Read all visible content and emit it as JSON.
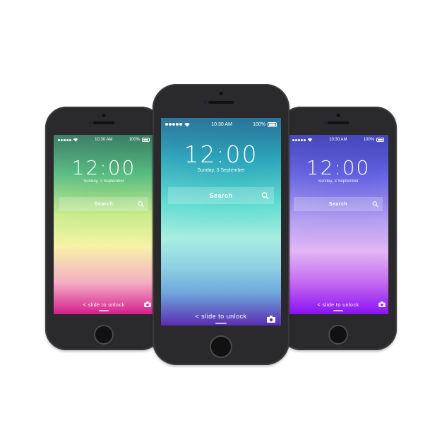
{
  "colors": {
    "green_screen": [
      "#1d6a4f",
      "#4fb87a",
      "#c8ec8a",
      "#f6f3a6",
      "#f4b0c4",
      "#d61f8e"
    ],
    "teal_screen": [
      "#0b5f8a",
      "#1ea0b6",
      "#5fdcd0",
      "#a7ede1",
      "#6fa8dc",
      "#5a2db2"
    ],
    "purple_screen": [
      "#2a2ab0",
      "#5a58de",
      "#b49ef0",
      "#e2b6f5",
      "#c46cf0",
      "#8a12f2"
    ],
    "phone_body": "#2a2a2c"
  },
  "phones": [
    {
      "id": "left",
      "status_time": "10:30 AM",
      "battery": "100%",
      "clock": "12:00",
      "date": "Sunday, 3 September",
      "search_label": "Search",
      "unlock_text": "< slide to unlock",
      "icons": [
        "signal-dots-icon",
        "wifi-icon",
        "battery-icon",
        "search-icon",
        "camera-icon"
      ]
    },
    {
      "id": "center",
      "status_time": "10:30 AM",
      "battery": "100%",
      "clock": "12:00",
      "date": "Sunday, 3 September",
      "search_label": "Search",
      "unlock_text": "< slide to unlock",
      "icons": [
        "signal-dots-icon",
        "wifi-icon",
        "battery-icon",
        "search-icon",
        "camera-icon"
      ]
    },
    {
      "id": "right",
      "status_time": "10:30 AM",
      "battery": "100%",
      "clock": "12:00",
      "date": "Sunday, 3 September",
      "search_label": "Search",
      "unlock_text": "< slide to unlock",
      "icons": [
        "signal-dots-icon",
        "wifi-icon",
        "battery-icon",
        "search-icon",
        "camera-icon"
      ]
    }
  ]
}
